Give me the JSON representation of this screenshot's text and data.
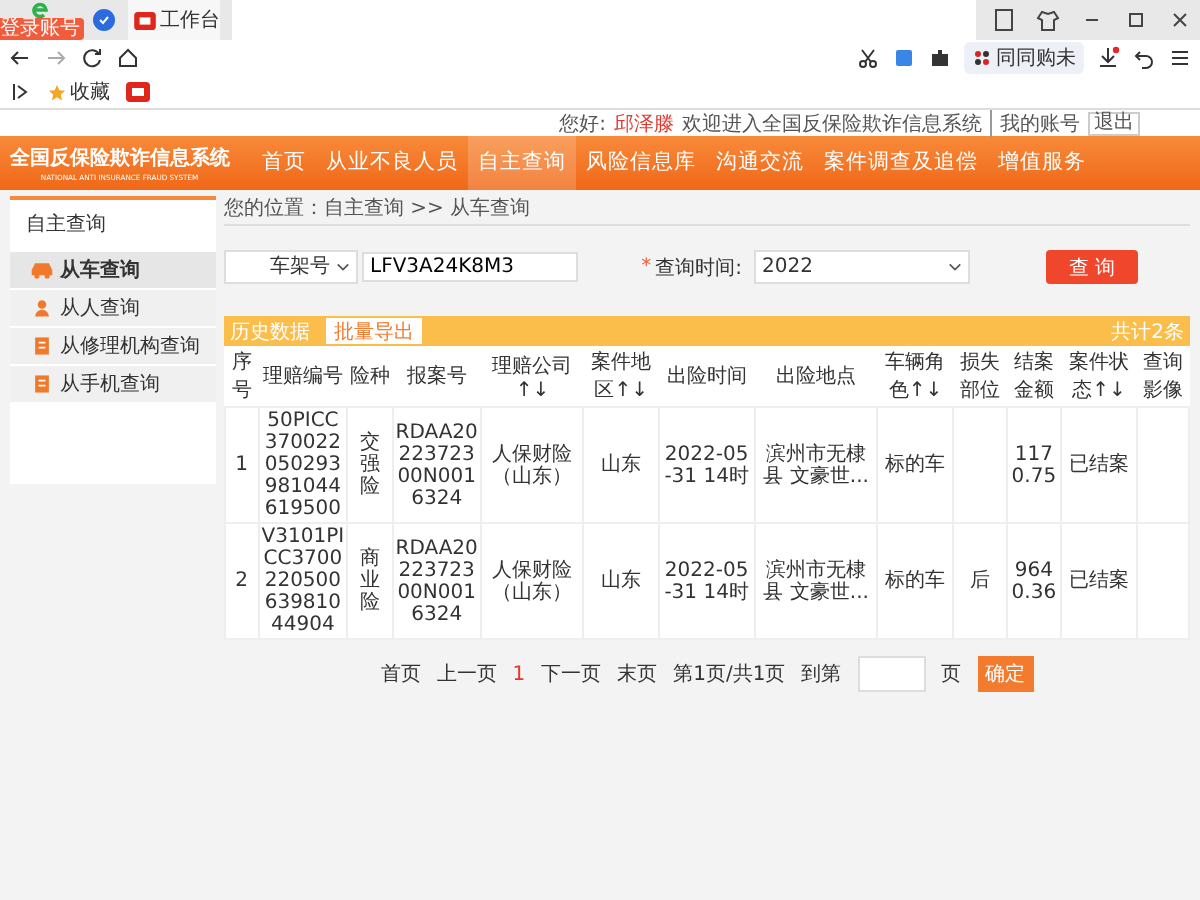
{
  "browser": {
    "app_badge": "登录账号",
    "tab_title": "工作台",
    "extension_label": "同同购未",
    "bookmarks": [
      {
        "label": "收藏"
      }
    ]
  },
  "user_bar": {
    "greeting": "您好:",
    "user": "邱泽滕",
    "welcome": "欢迎进入全国反保险欺诈信息系统",
    "account_link": "我的账号",
    "logout": "退出"
  },
  "logo": {
    "title": "全国反保险欺诈信息系统",
    "subtitle": "NATIONAL ANTI INSURANCE FRAUD SYSTEM"
  },
  "nav": [
    {
      "label": "首页",
      "selected": false
    },
    {
      "label": "从业不良人员",
      "selected": false
    },
    {
      "label": "自主查询",
      "selected": true
    },
    {
      "label": "风险信息库",
      "selected": false
    },
    {
      "label": "沟通交流",
      "selected": false
    },
    {
      "label": "案件调查及追偿",
      "selected": false
    },
    {
      "label": "增值服务",
      "selected": false
    }
  ],
  "sidebar": {
    "title": "自主查询",
    "items": [
      {
        "label": "从车查询",
        "kind": "car",
        "selected": true
      },
      {
        "label": "从人查询",
        "kind": "person",
        "selected": false
      },
      {
        "label": "从修理机构查询",
        "kind": "doc",
        "selected": false
      },
      {
        "label": "从手机查询",
        "kind": "doc",
        "selected": false
      }
    ]
  },
  "breadcrumb": "您的位置：自主查询 >> 从车查询",
  "search": {
    "type_value": "车架号",
    "vin_value": "LFV3A24K8M3",
    "required_mark": "*",
    "time_label": "查询时间:",
    "time_value": "2022",
    "button": "查 询"
  },
  "table": {
    "title": "历史数据",
    "export_button": "批量导出",
    "total": "共计2条",
    "columns": [
      "序号",
      "理赔编号",
      "险种",
      "报案号",
      "理赔公司↑↓",
      "案件地区↑↓",
      "出险时间",
      "出险地点",
      "车辆角色↑↓",
      "损失部位",
      "结案金额",
      "案件状态↑↓",
      "查询影像"
    ],
    "rows": [
      [
        "1",
        "50PICC370022050293981044619500",
        "交强险",
        "RDAA20223723 00N0016324",
        "人保财险（山东）",
        "山东",
        "2022-05-31 14时",
        "滨州市无棣县 文豪世...",
        "标的车",
        null,
        "1170.75",
        "已结案",
        null
      ],
      [
        "2",
        "V3101PICC370022050063981044904",
        "商业险",
        "RDAA20223723 00N0016324",
        "人保财险（山东）",
        "山东",
        "2022-05-31 14时",
        "滨州市无棣县 文豪世...",
        "标的车",
        "后",
        "9640.36",
        "已结案",
        null
      ]
    ]
  },
  "pager": {
    "first": "首页",
    "prev": "上一页",
    "current": "1",
    "next": "下一页",
    "last": "末页",
    "info": "第1页/共1页",
    "goto": "到第",
    "unit": "页",
    "confirm": "确定"
  }
}
